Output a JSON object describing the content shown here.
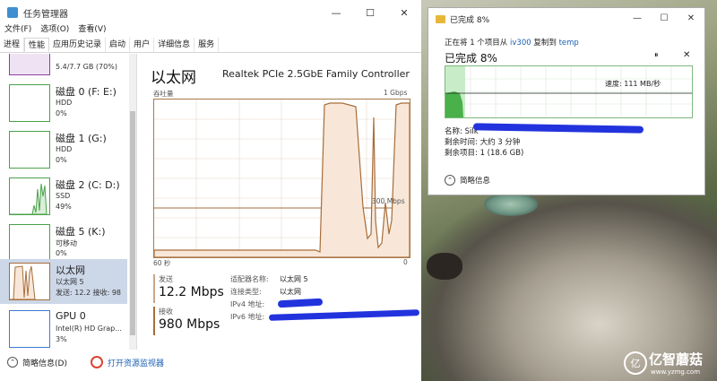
{
  "task_manager": {
    "title": "任务管理器",
    "menu": [
      "文件(F)",
      "选项(O)",
      "查看(V)"
    ],
    "tabs": [
      "进程",
      "性能",
      "应用历史记录",
      "启动",
      "用户",
      "详细信息",
      "服务"
    ],
    "active_tab": 1,
    "window_buttons": {
      "min": "—",
      "max": "☐",
      "close": "✕"
    },
    "sidebar": [
      {
        "title": "",
        "lines": [
          "5.4/7.7 GB (70%)"
        ]
      },
      {
        "title": "磁盘 0 (F: E:)",
        "lines": [
          "HDD",
          "0%"
        ]
      },
      {
        "title": "磁盘 1 (G:)",
        "lines": [
          "HDD",
          "0%"
        ]
      },
      {
        "title": "磁盘 2 (C: D:)",
        "lines": [
          "SSD",
          "49%"
        ]
      },
      {
        "title": "磁盘 5 (K:)",
        "lines": [
          "可移动",
          "0%"
        ]
      },
      {
        "title": "以太网",
        "lines": [
          "以太网 5",
          "发送: 12.2 接收: 98"
        ]
      },
      {
        "title": "GPU 0",
        "lines": [
          "Intel(R) HD Grap...",
          "3%"
        ]
      }
    ],
    "main": {
      "title": "以太网",
      "adapter": "Realtek PCIe 2.5GbE Family Controller",
      "graph_label_left": "吞吐量",
      "graph_label_right": "1 Gbps",
      "mid_label": "300 Mbps",
      "time_label": "60 秒",
      "zero_label": "0",
      "send_label": "发送",
      "send_value": "12.2 Mbps",
      "recv_label": "接收",
      "recv_value": "980 Mbps",
      "props": [
        {
          "k": "适配器名称:",
          "v": "以太网 5"
        },
        {
          "k": "连接类型:",
          "v": "以太网"
        },
        {
          "k": "IPv4 地址:",
          "v": ""
        },
        {
          "k": "IPv6 地址:",
          "v": ""
        }
      ]
    },
    "footer": {
      "brief": "简略信息(D)",
      "monitor": "打开资源监视器"
    }
  },
  "copy_dialog": {
    "title": "已完成 8%",
    "line1_prefix": "正在将 1 个项目从",
    "line1_src": "iv300",
    "line1_mid": "复制到",
    "line1_dst": "temp",
    "big": "已完成 8%",
    "pause": "⏸",
    "close": "✕",
    "speed": "速度: 111 MB/秒",
    "name_label": "名称:",
    "name_value": "Silk",
    "remaining_time": "剩余时间: 大约 3 分钟",
    "remaining_items": "剩余项目: 1 (18.6 GB)",
    "detail": "简略信息",
    "progress_fraction": 0.08
  },
  "watermark": {
    "logo": "亿",
    "text": "亿智蘑菇",
    "sub": "www.yzmg.com"
  },
  "colors": {
    "eth_line": "#a76d3a",
    "eth_fill": "#f8e7d8",
    "disk_green": "#4aa14a",
    "gpu_blue": "#3a7bd5",
    "memory_purple": "#8b3fa0",
    "redact_blue": "#2233dd",
    "link_blue": "#1a5fb4",
    "copy_green": "#4ab04a"
  }
}
